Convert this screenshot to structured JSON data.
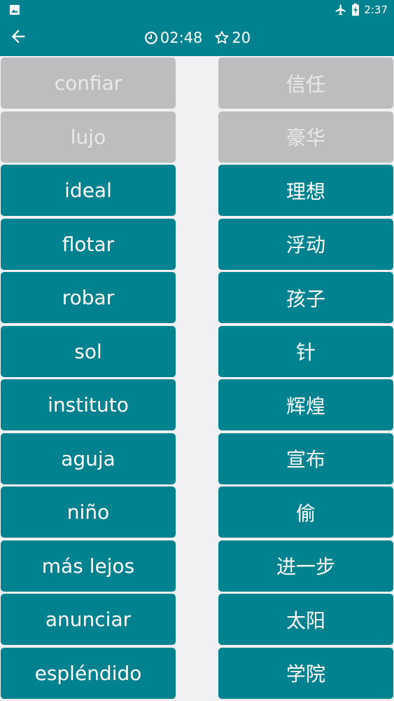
{
  "status_bar": {
    "time": "2:37",
    "icons": [
      "gallery-icon",
      "airplane-mode-icon",
      "battery-charging-icon"
    ]
  },
  "header": {
    "back_icon": "arrow-left-icon",
    "timer": "02:48",
    "timer_icon": "clock-icon",
    "score": "20",
    "score_icon": "star-outline-icon"
  },
  "colors": {
    "primary": "#00838f",
    "matched": "#bdbcbf",
    "background": "#f1f0f2"
  },
  "left_words": [
    {
      "text": "confiar",
      "matched": true
    },
    {
      "text": "lujo",
      "matched": true
    },
    {
      "text": "ideal",
      "matched": false
    },
    {
      "text": "flotar",
      "matched": false
    },
    {
      "text": "robar",
      "matched": false
    },
    {
      "text": "sol",
      "matched": false
    },
    {
      "text": "instituto",
      "matched": false
    },
    {
      "text": "aguja",
      "matched": false
    },
    {
      "text": "niño",
      "matched": false
    },
    {
      "text": "más lejos",
      "matched": false
    },
    {
      "text": "anunciar",
      "matched": false
    },
    {
      "text": "espléndido",
      "matched": false
    }
  ],
  "right_words": [
    {
      "text": "信任",
      "matched": true
    },
    {
      "text": "豪华",
      "matched": true
    },
    {
      "text": "理想",
      "matched": false
    },
    {
      "text": "浮动",
      "matched": false
    },
    {
      "text": "孩子",
      "matched": false
    },
    {
      "text": "针",
      "matched": false
    },
    {
      "text": "辉煌",
      "matched": false
    },
    {
      "text": "宣布",
      "matched": false
    },
    {
      "text": "偷",
      "matched": false
    },
    {
      "text": "进一步",
      "matched": false
    },
    {
      "text": "太阳",
      "matched": false
    },
    {
      "text": "学院",
      "matched": false
    }
  ]
}
